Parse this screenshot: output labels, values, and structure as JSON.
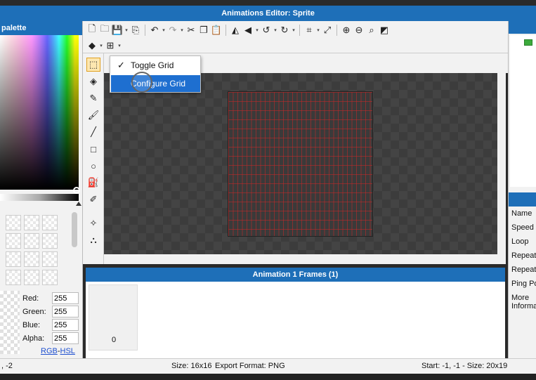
{
  "window": {
    "title": "Animations Editor: Sprite"
  },
  "palette": {
    "title": "palette",
    "colors": [
      {
        "label": "Red:",
        "value": "255"
      },
      {
        "label": "Green:",
        "value": "255"
      },
      {
        "label": "Blue:",
        "value": "255"
      },
      {
        "label": "Alpha:",
        "value": "255"
      }
    ],
    "mode_rgb": "RGB",
    "mode_sep": "-",
    "mode_hsl": "HSL"
  },
  "toolbar": {
    "row1": [
      "new-file-icon",
      "open-folder-icon",
      "save-icon",
      "export-icon",
      "undo-icon",
      "redo-icon",
      "cut-icon",
      "copy-icon",
      "paste-icon",
      "flip-horizontal-icon",
      "flip-vertical-icon",
      "rotate-left-icon",
      "rotate-right-icon",
      "crop-icon",
      "resize-icon",
      "zoom-in-icon",
      "zoom-out-icon",
      "zoom-reset-icon",
      "fit-icon"
    ],
    "row2": [
      "layers-icon",
      "grid-icon"
    ]
  },
  "tools": [
    "select-rect-icon",
    "eraser-icon",
    "pencil-icon",
    "brush-icon",
    "line-icon",
    "rectangle-icon",
    "ellipse-icon",
    "fill-bucket-icon",
    "eyedropper-icon",
    "pivot-icon",
    "anchor-points-icon"
  ],
  "grid_menu": {
    "items": [
      {
        "label": "Toggle Grid",
        "checked": true,
        "highlighted": false
      },
      {
        "label": "Configure Grid",
        "checked": false,
        "highlighted": true
      }
    ]
  },
  "frames": {
    "title": "Animation 1 Frames (1)",
    "items": [
      {
        "index": "0"
      }
    ]
  },
  "properties": {
    "rows": [
      "Name",
      "Speed",
      "Loop",
      "Repeat",
      "Repeat",
      "Ping Po",
      "More Informa"
    ]
  },
  "status": {
    "cursor": ", -2",
    "size": "Size: 16x16",
    "export": "Export Format: PNG",
    "selection": "Start: -1, -1 - Size: 20x19"
  },
  "colors": {
    "accent": "#1e6fb8",
    "highlight": "#1e6fd0",
    "grid_line": "#c82828"
  }
}
